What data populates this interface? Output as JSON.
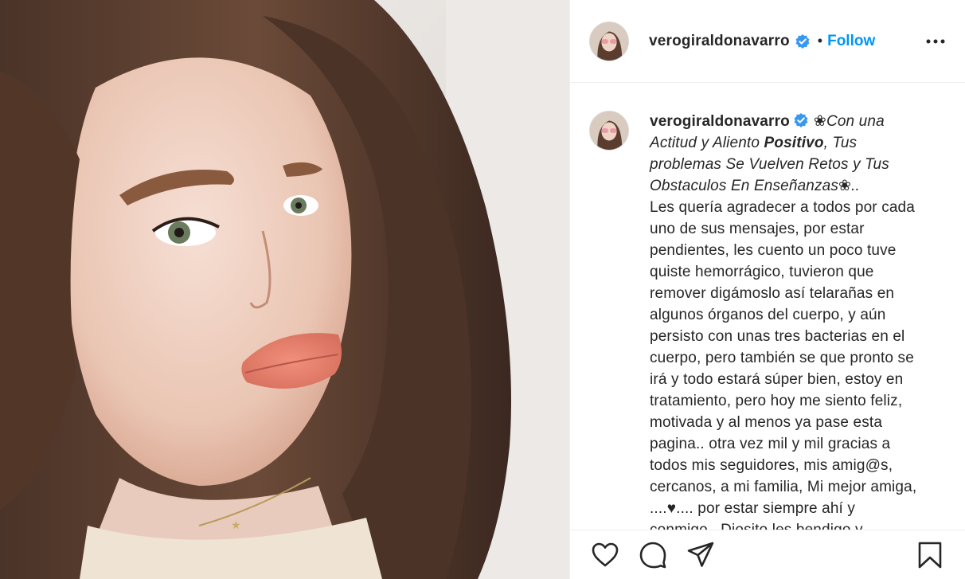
{
  "post": {
    "username": "verogiraldonavarro",
    "verified": true,
    "separator": "•",
    "follow_label": "Follow",
    "more_icon": "more-horizontal-icon"
  },
  "caption": {
    "username": "verogiraldonavarro",
    "flower_open": "❀",
    "line_a": "Con una Actitud y Aliento ",
    "line_a_bold": "Positivo",
    "line_b": ", Tus problemas Se Vuelven Retos y Tus Obstaculos En Enseñanzas",
    "flower_close": "❀",
    "line_b_end": "..",
    "body": "Les quería agradecer a todos por cada uno de sus mensajes, por estar pendientes, les cuento un poco tuve quiste hemorrágico, tuvieron que remover digámoslo así telarañas en algunos órganos del cuerpo, y aún persisto con unas tres bacterias en el cuerpo, pero también se que pronto se irá y todo estará súper bien, estoy en tratamiento, pero hoy me siento feliz, motivada y al menos ya pase esta pagina.. otra vez mil y mil gracias a todos mis seguidores, mis amig@s, cercanos, a mi familia, Mi mejor amiga, ....♥.... por estar siempre ahí y conmigo.. Diosito les bendigo y"
  },
  "actions": {
    "like_icon": "heart-icon",
    "comment_icon": "comment-icon",
    "share_icon": "share-icon",
    "save_icon": "bookmark-icon"
  },
  "colors": {
    "accent": "#0095f6",
    "verified_badge": "#3897f0",
    "text": "#262626",
    "divider": "#efefef"
  }
}
